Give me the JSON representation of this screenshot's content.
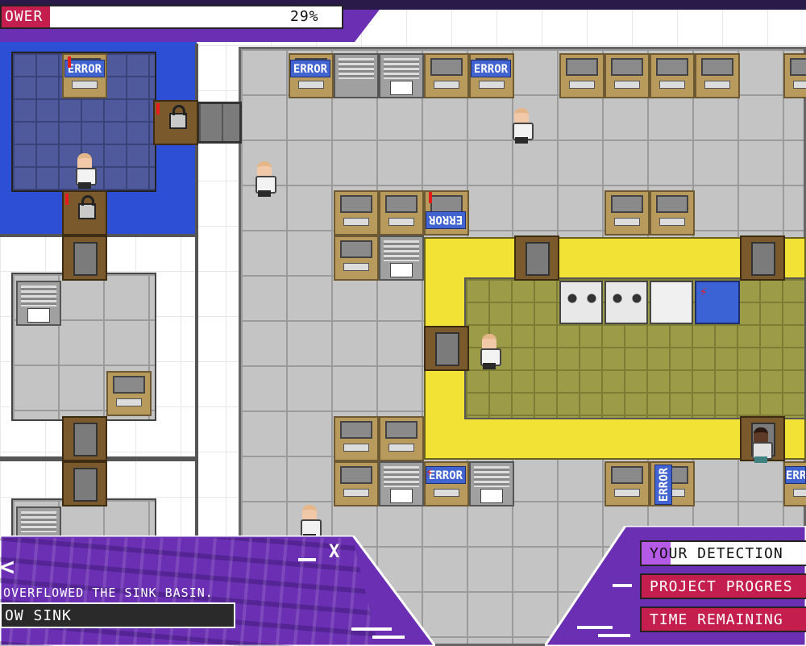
{
  "power": {
    "label": "OWER",
    "value": "29%"
  },
  "notification": {
    "message": "OVERFLOWED THE SINK BASIN.",
    "item_name": "OW SINK",
    "back_glyph": "<",
    "close_glyph": "X"
  },
  "status_panel": {
    "detection_label": "YOUR DETECTION",
    "progress_label": "PROJECT PROGRES",
    "time_label": "TIME REMAINING"
  },
  "map": {
    "error_sign_text": "ERROR"
  },
  "colors": {
    "power_bar": "#c41e4e",
    "detection_bar": "#b45ae6",
    "progress_bar": "#c41e4e",
    "time_bar": "#c41e4e",
    "panel_purple": "#6a2fb2",
    "error_sign": "#4164d1"
  },
  "icons": {
    "lock": "padlock-icon",
    "alert": "exclamation-icon",
    "bolt": "lightning-icon"
  }
}
